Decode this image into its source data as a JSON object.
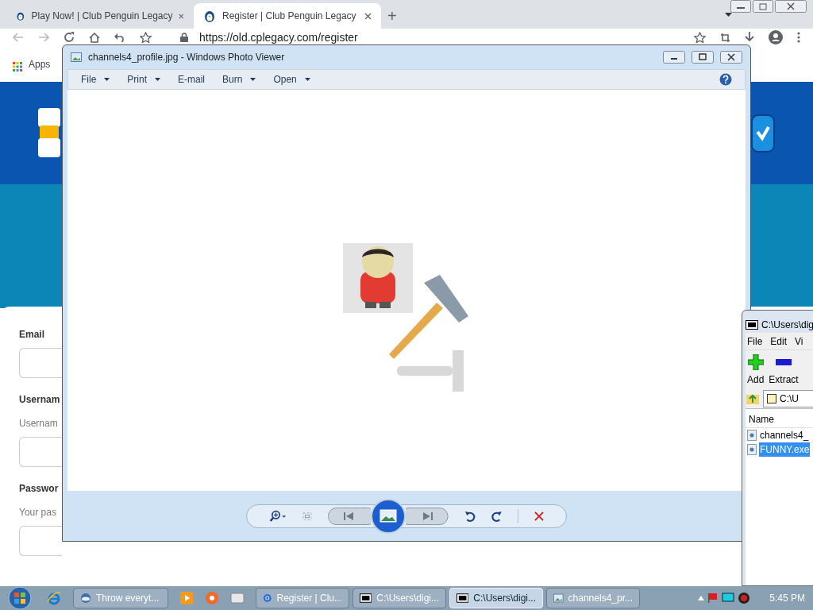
{
  "browser": {
    "tabs": [
      {
        "title": "Play Now! | Club Penguin Legacy",
        "selected": false
      },
      {
        "title": "Register | Club Penguin Legacy",
        "selected": true
      }
    ],
    "new_tab": "+",
    "address": "https://old.cplegacy.com/register",
    "bookmarks": [
      "Apps"
    ]
  },
  "form": {
    "fields": [
      {
        "label": "Email"
      },
      {
        "label": "Usernam",
        "hint": "Usernam"
      },
      {
        "label": "Passwor",
        "hint": "Your pas"
      }
    ]
  },
  "photo_viewer": {
    "title": "channels4_profile.jpg - Windows Photo Viewer",
    "menu": [
      {
        "label": "File",
        "dropdown": true
      },
      {
        "label": "Print",
        "dropdown": true
      },
      {
        "label": "E-mail",
        "dropdown": false
      },
      {
        "label": "Burn",
        "dropdown": true
      },
      {
        "label": "Open",
        "dropdown": true
      }
    ]
  },
  "archive_window": {
    "title": "C:\\Users\\dig",
    "menu": [
      "File",
      "Edit",
      "Vi"
    ],
    "tools": [
      {
        "label": "Add",
        "kind": "add"
      },
      {
        "label": "Extract",
        "kind": "extract"
      }
    ],
    "path": "C:\\U",
    "column": "Name",
    "files": [
      {
        "name": "channels4_",
        "selected": false
      },
      {
        "name": "FUNNY.exe",
        "selected": true
      }
    ]
  },
  "taskbar": {
    "tasks": [
      {
        "label": "Throw everyt...",
        "kind": "game",
        "selected": false
      },
      {
        "label": "Register | Clu...",
        "kind": "browser",
        "selected": false
      },
      {
        "label": "C:\\Users\\digi...",
        "kind": "archive",
        "selected": false
      },
      {
        "label": "C:\\Users\\digi...",
        "kind": "archive",
        "selected": true
      },
      {
        "label": "channels4_pr...",
        "kind": "viewer",
        "selected": false
      }
    ],
    "time": "5:45 PM"
  }
}
